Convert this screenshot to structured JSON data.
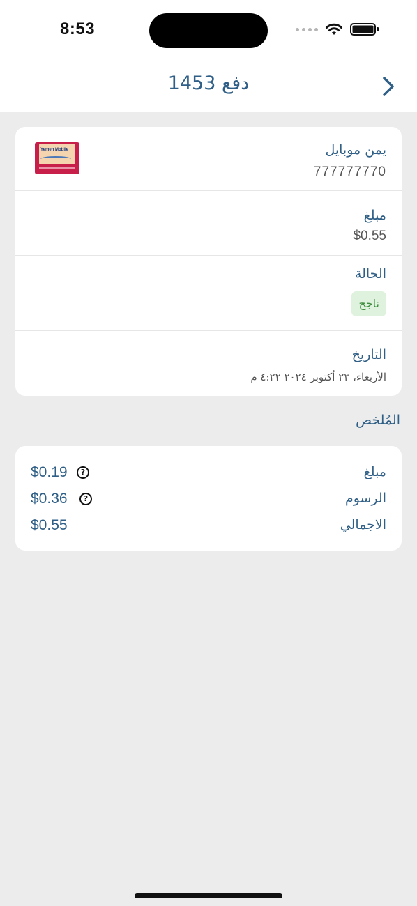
{
  "status_bar": {
    "time": "8:53"
  },
  "nav": {
    "title": "دفع 1453"
  },
  "details": {
    "provider_name": "يمن موبايل",
    "phone_number": "777777770",
    "logo_text": "Yemen Mobile",
    "amount_label": "مبلغ",
    "amount_value": "$0.55",
    "status_label": "الحالة",
    "status_badge": "ناجح",
    "date_label": "التاريخ",
    "date_value": "الأربعاء، ٢٣ أكتوبر ٢٠٢٤ ٤:٢٢ م"
  },
  "summary": {
    "title": "المُلخص",
    "rows": [
      {
        "label": "مبلغ",
        "value": "$0.19"
      },
      {
        "label": "الرسوم",
        "value": "$0.36"
      },
      {
        "label": "الاجمالي",
        "value": "$0.55"
      }
    ]
  },
  "colors": {
    "accent": "#2f5f86",
    "success_bg": "#dff2de",
    "success_text": "#3e8e3e",
    "background": "#ececec"
  },
  "icons": [
    "chevron-right-icon",
    "help-icon",
    "wifi-icon",
    "battery-icon",
    "signal-icon"
  ]
}
